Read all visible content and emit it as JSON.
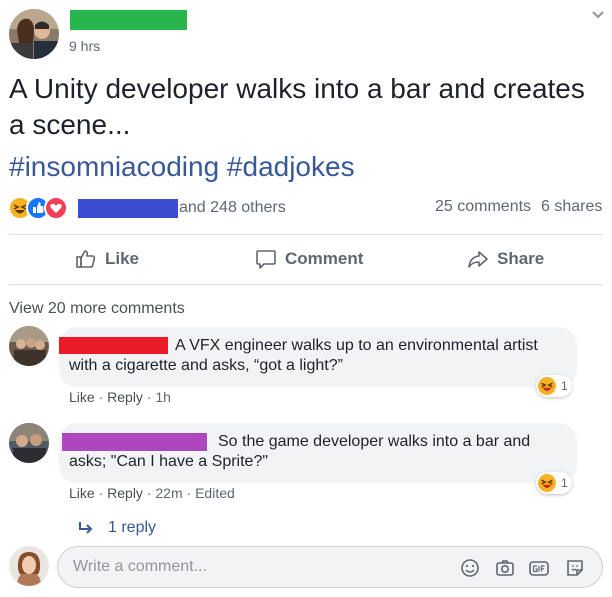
{
  "post": {
    "time": "9 hrs",
    "text": "A Unity developer walks into a bar and creates a scene...",
    "hashtags": [
      "#insomniacoding",
      "#dadjokes"
    ]
  },
  "reactions": {
    "others_text": "and 248 others",
    "comments": "25 comments",
    "shares": "6 shares",
    "icons": [
      "haha-icon",
      "like-icon",
      "love-icon"
    ]
  },
  "actions": {
    "like": "Like",
    "comment": "Comment",
    "share": "Share"
  },
  "comments": {
    "view_more": "View 20 more comments",
    "items": [
      {
        "line1": "A VFX engineer walks up to an environmental artist",
        "line2": "with a cigarette and asks, “got a light?”",
        "reaction_count": "1",
        "like": "Like",
        "reply": "Reply",
        "time": "1h",
        "edited": ""
      },
      {
        "line1": "So the game developer walks into a bar and",
        "line2": "asks; \"Can I have a Sprite?\"",
        "reaction_count": "1",
        "like": "Like",
        "reply": "Reply",
        "time": "22m",
        "edited": "Edited"
      }
    ],
    "reply_link": "1 reply"
  },
  "composer": {
    "placeholder": "Write a comment..."
  },
  "colors": {
    "link": "#385898",
    "muted": "#606770",
    "redact_author": "#29b44c",
    "redact_reactor": "#3a4dd0",
    "redact_c1": "#ea1a29",
    "redact_c2": "#ae47bf"
  }
}
